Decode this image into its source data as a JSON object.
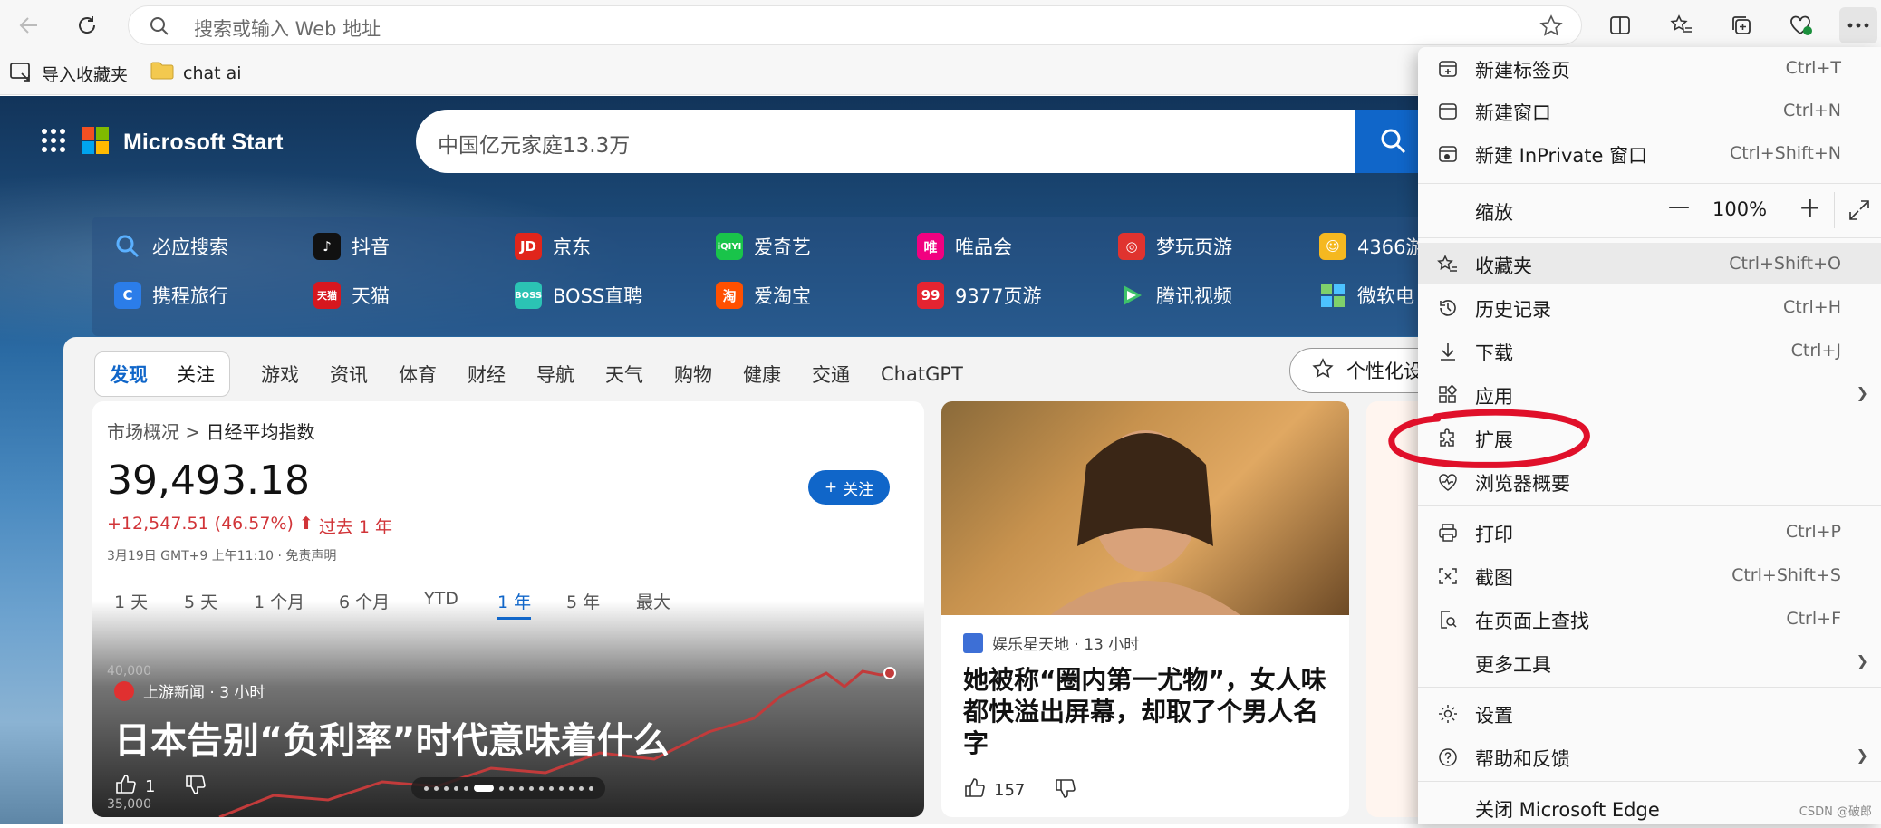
{
  "toolbar": {
    "address_placeholder": "搜索或输入 Web 地址"
  },
  "bookmarks": [
    {
      "label": "导入收藏夹"
    },
    {
      "label": "chat ai"
    }
  ],
  "msn": {
    "brand": "Microsoft Start",
    "search_text": "中国亿元家庭13.3万",
    "quicklinks_row1": [
      "必应搜索",
      "抖音",
      "京东",
      "爱奇艺",
      "唯品会",
      "梦玩页游",
      "4366游"
    ],
    "quicklinks_row2": [
      "携程旅行",
      "天猫",
      "BOSS直聘",
      "爱淘宝",
      "9377页游",
      "腾讯视频",
      "微软电"
    ],
    "pill_tabs": [
      "发现",
      "关注"
    ],
    "nav_tabs": [
      "游戏",
      "资讯",
      "体育",
      "财经",
      "导航",
      "天气",
      "购物",
      "健康",
      "交通",
      "ChatGPT"
    ],
    "personalize": "个性化设"
  },
  "market": {
    "breadcrumb_a": "市场概况",
    "breadcrumb_sep": ">",
    "breadcrumb_b": "日经平均指数",
    "price": "39,493.18",
    "change": "+12,547.51 (46.57%)",
    "change_period": "过去 1 年",
    "timestamp": "3月19日 GMT+9 上午11:10 · 免责声明",
    "follow": "关注",
    "periods": [
      "1 天",
      "5 天",
      "1 个月",
      "6 个月",
      "YTD",
      "1 年",
      "5 年",
      "最大"
    ],
    "selected_period": "1 年",
    "y_tick_top": "40,000",
    "y_tick_bottom": "35,000",
    "source": "上游新闻 · 3 小时",
    "headline": "日本告别“负利率”时代意味着什么",
    "likes": "1"
  },
  "photo_card": {
    "source": "娱乐星天地 · 13 小时",
    "headline": "她被称“圈内第一尤物”，女人味都快溢出屏幕，却取了个男人名字",
    "likes": "157"
  },
  "menu": {
    "items": [
      {
        "label": "新建标签页",
        "key": "Ctrl+T"
      },
      {
        "label": "新建窗口",
        "key": "Ctrl+N"
      },
      {
        "label": "新建 InPrivate 窗口",
        "key": "Ctrl+Shift+N"
      },
      {
        "label": "缩放",
        "key": ""
      },
      {
        "label": "收藏夹",
        "key": "Ctrl+Shift+O"
      },
      {
        "label": "历史记录",
        "key": "Ctrl+H"
      },
      {
        "label": "下载",
        "key": "Ctrl+J"
      },
      {
        "label": "应用",
        "key": ""
      },
      {
        "label": "扩展",
        "key": ""
      },
      {
        "label": "浏览器概要",
        "key": ""
      },
      {
        "label": "打印",
        "key": "Ctrl+P"
      },
      {
        "label": "截图",
        "key": "Ctrl+Shift+S"
      },
      {
        "label": "在页面上查找",
        "key": "Ctrl+F"
      },
      {
        "label": "更多工具",
        "key": ""
      },
      {
        "label": "设置",
        "key": ""
      },
      {
        "label": "帮助和反馈",
        "key": ""
      },
      {
        "label": "关闭 Microsoft Edge",
        "key": ""
      }
    ],
    "zoom_value": "100%",
    "zoom_minus": "—",
    "zoom_plus": "+"
  },
  "watermark": "CSDN @破郎",
  "colors": {
    "accent": "#1066c9",
    "highlight_circle": "#e0102a",
    "gain_red": "#d13438"
  }
}
